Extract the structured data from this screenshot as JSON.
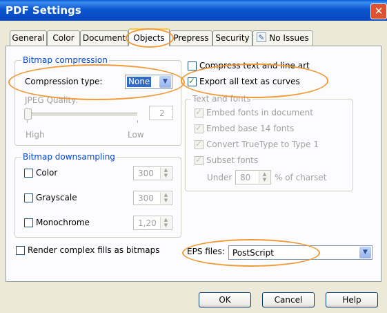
{
  "window": {
    "title": "PDF Settings"
  },
  "tabs": [
    {
      "label": "General"
    },
    {
      "label": "Color"
    },
    {
      "label": "Document"
    },
    {
      "label": "Objects"
    },
    {
      "label": "Prepress"
    },
    {
      "label": "Security"
    },
    {
      "label": "No Issues"
    }
  ],
  "bitmap_compression": {
    "legend": "Bitmap compression",
    "type_label": "Compression type:",
    "type_value": "None",
    "jpeg_label": "JPEG Quality:",
    "jpeg_value": "2",
    "high_label": "High",
    "low_label": "Low"
  },
  "bitmap_downsampling": {
    "legend": "Bitmap downsampling",
    "color_label": "Color",
    "color_value": "300",
    "grayscale_label": "Grayscale",
    "grayscale_value": "300",
    "monochrome_label": "Monochrome",
    "monochrome_value": "1,20"
  },
  "compress_text_label": "Compress text and line art",
  "export_curves_label": "Export all text as curves",
  "text_fonts": {
    "legend": "Text and fonts",
    "embed_fonts_label": "Embed fonts in document",
    "embed_base14_label": "Embed base 14 fonts",
    "convert_tt_label": "Convert TrueType to Type 1",
    "subset_label": "Subset fonts",
    "under_label": "Under",
    "under_value": "80",
    "charset_label": "% of charset"
  },
  "render_fills_label": "Render complex fills as bitmaps",
  "eps": {
    "label": "EPS files:",
    "value": "PostScript"
  },
  "buttons": {
    "ok": "OK",
    "cancel": "Cancel",
    "help": "Help"
  },
  "colors": {
    "titlebar": "#0A56D0",
    "highlight_oval": "#F29A35",
    "selection": "#316AC5",
    "legend_text": "#0046D5"
  }
}
